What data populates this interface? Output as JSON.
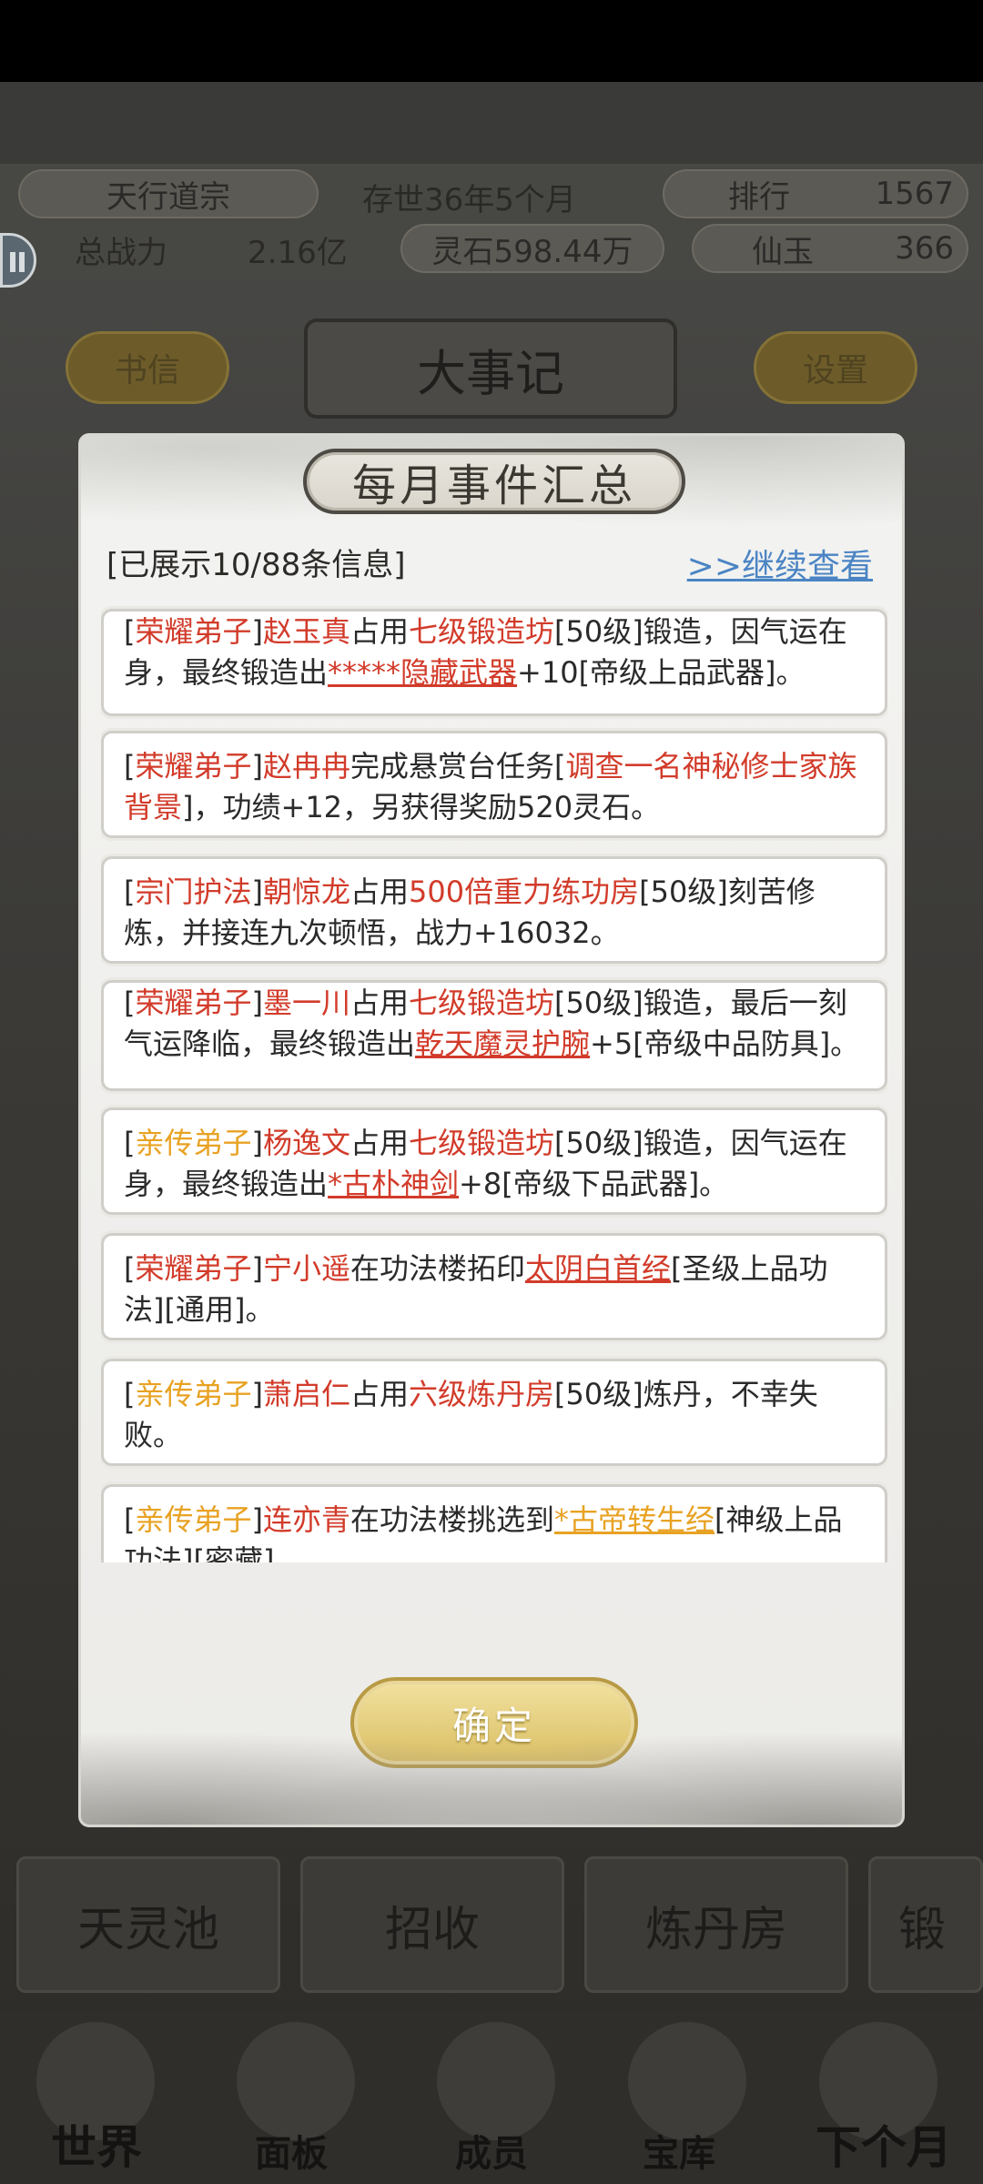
{
  "header": {
    "sect_name": "天行道宗",
    "age": "存世36年5个月",
    "rank_label": "排行",
    "rank_value": "1567",
    "power_label": "总战力",
    "power_value": "2.16亿",
    "spirit_stone": "灵石598.44万",
    "jade_label": "仙玉",
    "jade_value": "366"
  },
  "background_buttons": {
    "letters": "书信",
    "events_title": "大事记",
    "settings": "设置"
  },
  "bottom_tiles": [
    "天灵池",
    "招收",
    "炼丹房",
    "锻"
  ],
  "nav": [
    "世界",
    "面板",
    "成员",
    "宝库",
    "下个月"
  ],
  "modal": {
    "title": "每月事件汇总",
    "info_count": "[已展示10/88条信息]",
    "more_link": ">>继续查看",
    "confirm": "确定",
    "events": [
      {
        "segments": [
          {
            "t": "[",
            "c": ""
          },
          {
            "t": "荣耀弟子",
            "c": "red"
          },
          {
            "t": "]",
            "c": ""
          },
          {
            "t": "赵玉真",
            "c": "red"
          },
          {
            "t": "占用",
            "c": ""
          },
          {
            "t": "七级锻造坊",
            "c": "red"
          },
          {
            "t": "[50级]锻造，因气运在身，最终锻造出",
            "c": ""
          },
          {
            "t": "*****隐藏武器",
            "c": "red ul"
          },
          {
            "t": "+10[帝级上品武器]。",
            "c": ""
          }
        ]
      },
      {
        "segments": [
          {
            "t": "[",
            "c": ""
          },
          {
            "t": "荣耀弟子",
            "c": "red"
          },
          {
            "t": "]",
            "c": ""
          },
          {
            "t": "赵冉冉",
            "c": "red"
          },
          {
            "t": "完成悬赏台任务[",
            "c": ""
          },
          {
            "t": "调查一名神秘修士家族背景",
            "c": "red"
          },
          {
            "t": "]，功绩+12，另获得奖励520灵石。",
            "c": ""
          }
        ]
      },
      {
        "segments": [
          {
            "t": "[",
            "c": ""
          },
          {
            "t": "宗门护法",
            "c": "red"
          },
          {
            "t": "]",
            "c": ""
          },
          {
            "t": "朝惊龙",
            "c": "red"
          },
          {
            "t": "占用",
            "c": ""
          },
          {
            "t": "500倍重力练功房",
            "c": "red"
          },
          {
            "t": "[50级]刻苦修炼，并接连九次顿悟，战力+16032。",
            "c": ""
          }
        ]
      },
      {
        "segments": [
          {
            "t": "[",
            "c": ""
          },
          {
            "t": "荣耀弟子",
            "c": "red"
          },
          {
            "t": "]",
            "c": ""
          },
          {
            "t": "墨一川",
            "c": "red"
          },
          {
            "t": "占用",
            "c": ""
          },
          {
            "t": "七级锻造坊",
            "c": "red"
          },
          {
            "t": "[50级]锻造，最后一刻气运降临，最终锻造出",
            "c": ""
          },
          {
            "t": "乾天魔灵护腕",
            "c": "red ul"
          },
          {
            "t": "+5[帝级中品防具]。",
            "c": ""
          }
        ]
      },
      {
        "segments": [
          {
            "t": "[",
            "c": ""
          },
          {
            "t": "亲传弟子",
            "c": "orange"
          },
          {
            "t": "]",
            "c": ""
          },
          {
            "t": "杨逸文",
            "c": "red"
          },
          {
            "t": "占用",
            "c": ""
          },
          {
            "t": "七级锻造坊",
            "c": "red"
          },
          {
            "t": "[50级]锻造，因气运在身，最终锻造出",
            "c": ""
          },
          {
            "t": "*古朴神剑",
            "c": "red ul"
          },
          {
            "t": "+8[帝级下品武器]。",
            "c": ""
          }
        ]
      },
      {
        "segments": [
          {
            "t": "[",
            "c": ""
          },
          {
            "t": "荣耀弟子",
            "c": "red"
          },
          {
            "t": "]",
            "c": ""
          },
          {
            "t": "宁小遥",
            "c": "red"
          },
          {
            "t": "在功法楼拓印",
            "c": ""
          },
          {
            "t": "太阴白首经",
            "c": "red ul"
          },
          {
            "t": "[圣级上品功法][通用]。",
            "c": ""
          }
        ]
      },
      {
        "segments": [
          {
            "t": "[",
            "c": ""
          },
          {
            "t": "亲传弟子",
            "c": "orange"
          },
          {
            "t": "]",
            "c": ""
          },
          {
            "t": "萧启仁",
            "c": "red"
          },
          {
            "t": "占用",
            "c": ""
          },
          {
            "t": "六级炼丹房",
            "c": "red"
          },
          {
            "t": "[50级]炼丹，不幸失败。",
            "c": ""
          }
        ]
      },
      {
        "segments": [
          {
            "t": "[",
            "c": ""
          },
          {
            "t": "亲传弟子",
            "c": "orange"
          },
          {
            "t": "]",
            "c": ""
          },
          {
            "t": "连亦青",
            "c": "red"
          },
          {
            "t": "在功法楼挑选到",
            "c": ""
          },
          {
            "t": "*古帝转生经",
            "c": "orange ul"
          },
          {
            "t": "[神级上品功法][密藏]。",
            "c": ""
          }
        ]
      }
    ]
  }
}
